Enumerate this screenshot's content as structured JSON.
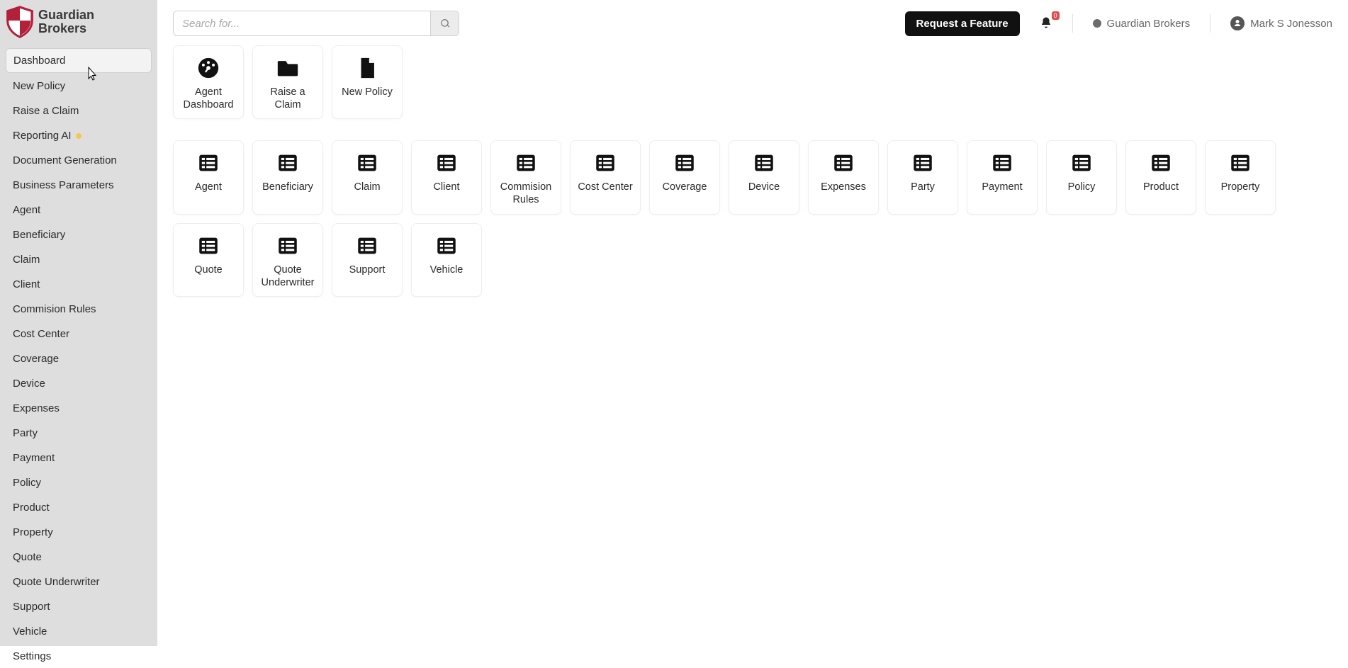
{
  "brand": {
    "line1": "Guardian",
    "line2": "Brokers"
  },
  "search": {
    "placeholder": "Search for..."
  },
  "topbar": {
    "request_feature": "Request a Feature",
    "notifications_count": "0",
    "org_name": "Guardian Brokers",
    "user_name": "Mark S Jonesson"
  },
  "sidebar": {
    "items": [
      {
        "label": "Dashboard",
        "active": true
      },
      {
        "label": "New Policy"
      },
      {
        "label": "Raise a Claim"
      },
      {
        "label": "Reporting AI",
        "badge": true
      },
      {
        "label": "Document Generation"
      },
      {
        "label": "Business Parameters"
      },
      {
        "label": "Agent"
      },
      {
        "label": "Beneficiary"
      },
      {
        "label": "Claim"
      },
      {
        "label": "Client"
      },
      {
        "label": "Commision Rules"
      },
      {
        "label": "Cost Center"
      },
      {
        "label": "Coverage"
      },
      {
        "label": "Device"
      },
      {
        "label": "Expenses"
      },
      {
        "label": "Party"
      },
      {
        "label": "Payment"
      },
      {
        "label": "Policy"
      },
      {
        "label": "Product"
      },
      {
        "label": "Property"
      },
      {
        "label": "Quote"
      },
      {
        "label": "Quote Underwriter"
      },
      {
        "label": "Support"
      },
      {
        "label": "Vehicle"
      },
      {
        "label": "Settings"
      }
    ]
  },
  "quick_actions": [
    {
      "label": "Agent Dashboard",
      "icon": "dashboard"
    },
    {
      "label": "Raise a Claim",
      "icon": "folder"
    },
    {
      "label": "New Policy",
      "icon": "file"
    }
  ],
  "modules": [
    {
      "label": "Agent"
    },
    {
      "label": "Beneficiary"
    },
    {
      "label": "Claim"
    },
    {
      "label": "Client"
    },
    {
      "label": "Commision Rules"
    },
    {
      "label": "Cost Center"
    },
    {
      "label": "Coverage"
    },
    {
      "label": "Device"
    },
    {
      "label": "Expenses"
    },
    {
      "label": "Party"
    },
    {
      "label": "Payment"
    },
    {
      "label": "Policy"
    },
    {
      "label": "Product"
    },
    {
      "label": "Property"
    },
    {
      "label": "Quote"
    },
    {
      "label": "Quote Underwriter"
    },
    {
      "label": "Support"
    },
    {
      "label": "Vehicle"
    }
  ]
}
